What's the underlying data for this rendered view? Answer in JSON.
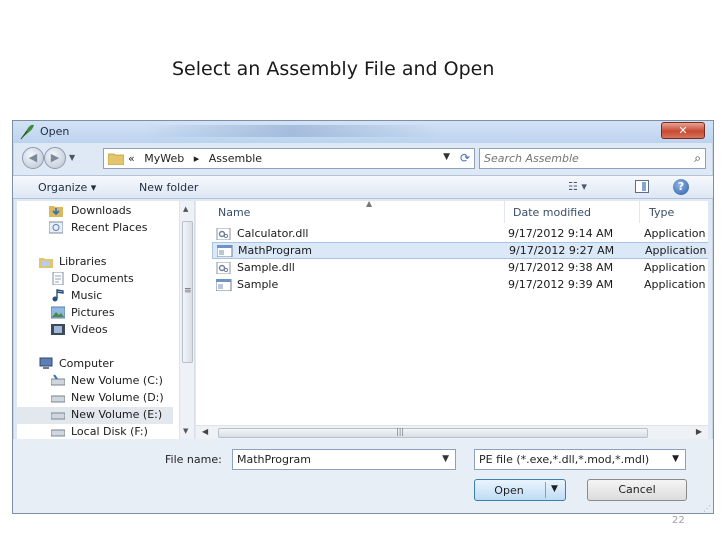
{
  "slide": {
    "title": "Select an Assembly File and Open",
    "page_number": "22"
  },
  "dialog": {
    "title": "Open",
    "close_label": "✕",
    "breadcrumbs": [
      "«",
      "MyWeb",
      "▸",
      "Assemble"
    ],
    "search_placeholder": "Search Assemble",
    "toolbar": {
      "organize_label": "Organize ▾",
      "new_folder_label": "New folder",
      "views_label": "☷ ▾",
      "help_label": "?"
    },
    "nav_items": [
      {
        "label": "Downloads",
        "icon": "downloads-folder-icon"
      },
      {
        "label": "Recent Places",
        "icon": "recent-places-icon"
      },
      {
        "label": "Libraries",
        "icon": "libraries-icon"
      },
      {
        "label": "Documents",
        "icon": "documents-icon"
      },
      {
        "label": "Music",
        "icon": "music-icon"
      },
      {
        "label": "Pictures",
        "icon": "pictures-icon"
      },
      {
        "label": "Videos",
        "icon": "videos-icon"
      },
      {
        "label": "Computer",
        "icon": "computer-icon"
      },
      {
        "label": "New Volume (C:)",
        "icon": "drive-icon"
      },
      {
        "label": "New Volume (D:)",
        "icon": "drive-icon"
      },
      {
        "label": "New Volume (E:)",
        "icon": "drive-icon",
        "selected": true
      },
      {
        "label": "Local Disk (F:)",
        "icon": "drive-icon"
      }
    ],
    "columns": {
      "name": "Name",
      "date": "Date modified",
      "type": "Type"
    },
    "files": [
      {
        "name": "Calculator.dll",
        "date": "9/17/2012 9:14 AM",
        "type": "Application",
        "icon": "dll-icon"
      },
      {
        "name": "MathProgram",
        "date": "9/17/2012 9:27 AM",
        "type": "Application",
        "icon": "exe-icon",
        "selected": true
      },
      {
        "name": "Sample.dll",
        "date": "9/17/2012 9:38 AM",
        "type": "Application",
        "icon": "dll-icon"
      },
      {
        "name": "Sample",
        "date": "9/17/2012 9:39 AM",
        "type": "Application",
        "icon": "exe-icon"
      }
    ],
    "file_name_label": "File name:",
    "file_name_value": "MathProgram",
    "filter_value": "PE file (*.exe,*.dll,*.mod,*.mdl)",
    "open_label": "Open",
    "cancel_label": "Cancel"
  }
}
